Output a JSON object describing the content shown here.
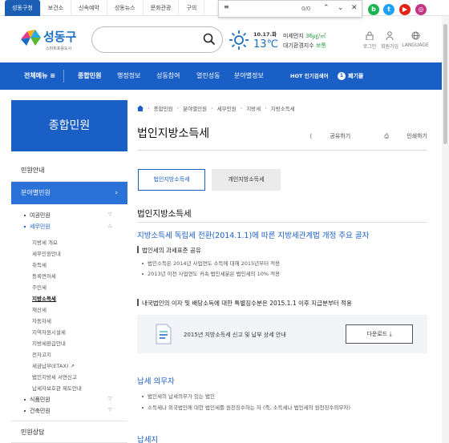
{
  "top_tabs": [
    {
      "label": "성동구청",
      "active": true
    },
    {
      "label": "보건소"
    },
    {
      "label": "신속예약"
    },
    {
      "label": "성동뉴스"
    },
    {
      "label": "문화관광"
    },
    {
      "label": "구의"
    }
  ],
  "find_bar": {
    "query": "≡",
    "count": "0/0"
  },
  "sns": [
    {
      "label": "b",
      "color": "#19b453",
      "icon": "blog-icon"
    },
    {
      "label": "t",
      "color": "#1da1f2",
      "icon": "twitter-icon"
    },
    {
      "label": "▶",
      "color": "#e62117",
      "icon": "youtube-icon"
    },
    {
      "label": "◎",
      "color": "#c13584",
      "icon": "instagram-icon"
    }
  ],
  "logo": {
    "name": "성동구",
    "sub": "스마트포용도시"
  },
  "search": {
    "placeholder": ""
  },
  "weather": {
    "date": "10.17.화",
    "temp": "13℃"
  },
  "air": {
    "line1_label": "미세먼지",
    "line1_value": "36㎍/㎥",
    "line2_label": "대기환경지수",
    "line2_value": "보통"
  },
  "utils": [
    {
      "label": "로그인",
      "icon": "lock-icon"
    },
    {
      "label": "회원가입",
      "icon": "person-icon"
    },
    {
      "label": "LANGUAGE",
      "icon": "globe-icon"
    }
  ],
  "nav": {
    "all_menu": "전체메뉴 ≡",
    "items": [
      "종합민원",
      "행정정보",
      "성동참여",
      "열린성동",
      "분야별정보"
    ],
    "hot_label": "HOT 인기검색어",
    "hot_rank": "1",
    "hot_word": "폐기물"
  },
  "sidebar": {
    "title": "종합민원",
    "items": [
      "민원안내",
      "분야별민원"
    ],
    "sub": [
      {
        "label": "여권민원",
        "tri": "▽"
      },
      {
        "label": "세무민원",
        "tri": "△",
        "on": true
      }
    ],
    "sub3": [
      "지방세 개요",
      "세무민원안내",
      "취득세",
      "등록면허세",
      "주민세",
      "지방소득세",
      "재산세",
      "자동차세",
      "지역자원시설세",
      "지방세환급안내",
      "전자고지",
      "세금납부(ETAX) ↗",
      "법인지방세 서면신고",
      "납세자보호관 제도안내"
    ],
    "sub3_active": "지방소득세",
    "sub_after": [
      {
        "label": "식품민원",
        "tri": "▽"
      },
      {
        "label": "건축민원",
        "tri": "▽"
      }
    ],
    "bottom": "민원상담"
  },
  "breadcrumb": [
    "종합민원",
    "분야별민원",
    "세무민원",
    "지방세",
    "지방소득세"
  ],
  "page": {
    "title": "법인지방소득세",
    "share": "공유하기",
    "print": "인쇄하기",
    "tab_active": "법인지방소득세",
    "tab_inactive": "개인지방소득세",
    "section": "법인지방소득세",
    "h3_1": "지방소득세 독립세 전환(2014.1.1)에 따른 지방세관계법 개정 주요 골자",
    "h4_1": "법인세의 과세표준 공유",
    "list_1": [
      "법인소득은 2014년 사업연도 소득에 대해 2015년부터 적용",
      "2013년 이전 사업연도 귀속 법인세분은 법인세의 10% 적용"
    ],
    "h4_2": "내국법인의 이자 및 배당소득에 대한 특별징수분은 2015.1.1 이후 지급분부터 적용",
    "download_text": "2015년 지방소득세 신고 및 납부 상세 안내",
    "download_btn": "다운로드 ⤓",
    "h3_2": "납세 의무자",
    "list_2": [
      "법인세의 납세의무가 있는 법인",
      "소득세나 외국법인에 대한 법인세를 원천징수하는 자 (즉, 소득세나 법인세의 원천징수의무자)"
    ],
    "h3_3": "납세지"
  }
}
